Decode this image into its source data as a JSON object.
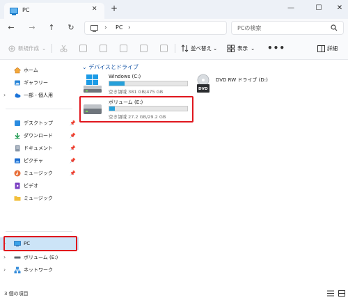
{
  "tab": {
    "title": "PC",
    "close": "✕",
    "new": "+"
  },
  "window": {
    "minimize": "—",
    "maximize": "☐",
    "close": "✕"
  },
  "nav": {
    "back": "←",
    "forward": "→",
    "up": "↑",
    "refresh": "↻"
  },
  "address": {
    "chevron1": "›",
    "location": "PC",
    "chevron2": "›"
  },
  "search": {
    "placeholder": "PCの検索"
  },
  "commandbar": {
    "new": "新規作成",
    "new_arrow": "⌄",
    "sort": "並べ替え",
    "sort_arrow": "⌄",
    "view": "表示",
    "view_arrow": "⌄",
    "more": "•••",
    "details": "詳細"
  },
  "sidebar": {
    "home": "ホーム",
    "gallery": "ギャラリー",
    "onedrive": "一部 - 個人用",
    "desktop": "デスクトップ",
    "downloads": "ダウンロード",
    "documents": "ドキュメント",
    "pictures": "ピクチャ",
    "music": "ミュージック",
    "videos": "ビデオ",
    "music_folder": "ミュージック",
    "pc": "PC",
    "volume": "ボリューム (E:)",
    "network": "ネットワーク",
    "chevron": "›",
    "pin": "📌"
  },
  "content": {
    "group_title": "デバイスとドライブ",
    "group_chevron": "⌄",
    "drives": [
      {
        "name": "Windows (C:)",
        "space": "空き領域 381 GB/475 GB",
        "used_fraction": 0.2
      },
      {
        "name": "DVD RW ドライブ (D:)",
        "badge": "DVD"
      },
      {
        "name": "ボリューム (E:)",
        "space": "空き領域 27.2 GB/29.2 GB",
        "used_fraction": 0.07
      }
    ]
  },
  "status": {
    "items": "3 個の項目"
  },
  "colors": {
    "accent": "#26a0da",
    "highlight": "#e0161d",
    "selected": "#cce4f7"
  }
}
